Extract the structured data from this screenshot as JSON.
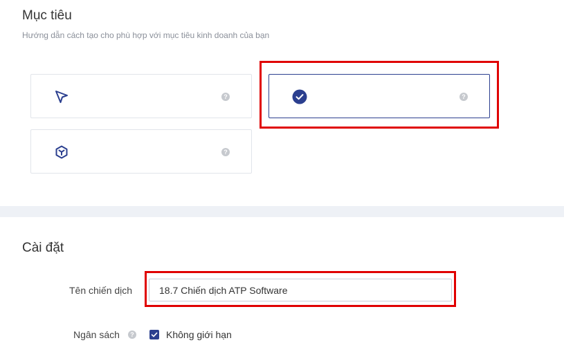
{
  "objective": {
    "title": "Mục tiêu",
    "subtitle": "Hướng dẫn cách tạo cho phù hợp với mục tiêu kinh doanh của bạn",
    "cards": [
      {
        "icon": "cursor-arrow-icon",
        "selected": false,
        "help": "?"
      },
      {
        "icon": "check-circle-icon",
        "selected": true,
        "help": "?"
      },
      {
        "icon": "cube-icon",
        "selected": false,
        "help": "?"
      }
    ]
  },
  "settings": {
    "title": "Cài đặt",
    "campaign_name_label": "Tên chiến dịch",
    "campaign_name_value": "18.7 Chiến dịch ATP Software",
    "budget_label": "Ngân sách",
    "budget_help": "?",
    "unlimited_label": "Không giới hạn",
    "unlimited_checked": true
  },
  "colors": {
    "accent": "#2b3f8f",
    "highlight": "#e00000"
  }
}
